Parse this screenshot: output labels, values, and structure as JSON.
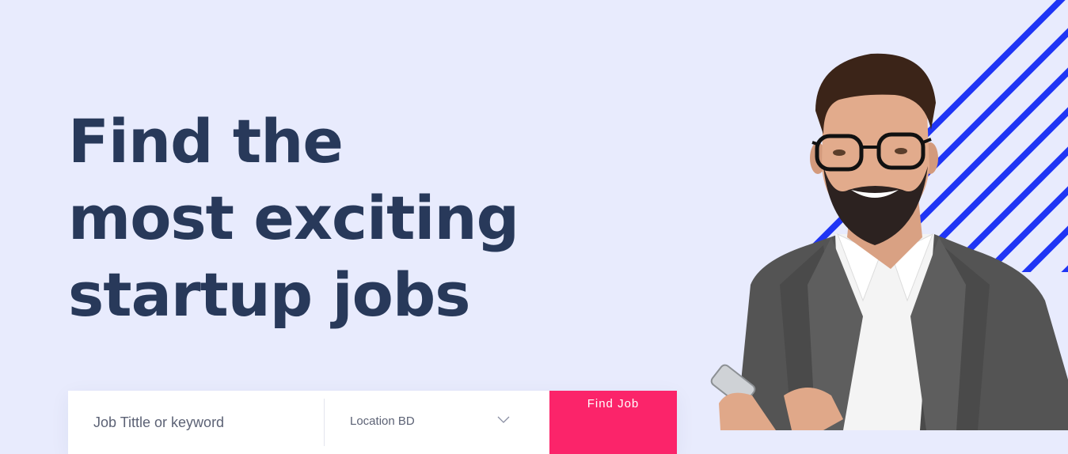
{
  "hero": {
    "title_lines": [
      "Find the",
      "most exciting",
      "startup jobs"
    ]
  },
  "search": {
    "keyword_placeholder": "Job Tittle or keyword",
    "location_selected": "Location BD",
    "button_label": "Find Job"
  },
  "colors": {
    "background": "#e8ebfd",
    "title": "#28395a",
    "accent_button": "#fb246a",
    "stripes": "#1f35f5"
  },
  "icons": {
    "location_dropdown": "chevron-down-icon"
  }
}
